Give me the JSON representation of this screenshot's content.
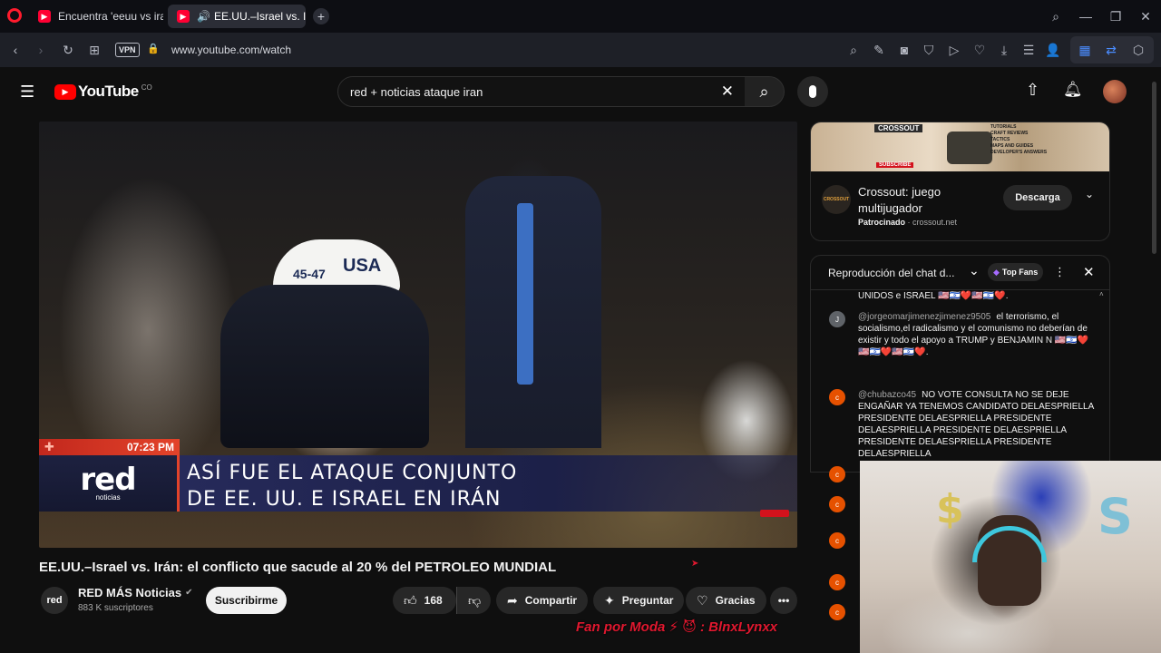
{
  "browser": {
    "tabs": [
      {
        "label": "Encuentra 'eeuu vs iran' en",
        "active": false
      },
      {
        "label": "EE.UU.–Israel vs. Irán: e",
        "active": true
      }
    ],
    "vpn_label": "VPN",
    "url": "www.youtube.com/watch"
  },
  "youtube": {
    "logo_text": "YouTube",
    "country_code": "CO",
    "search_value": "red + noticias ataque iran"
  },
  "video": {
    "time_overlay": "07:23 PM",
    "channel_logo": "red",
    "channel_logo_sub": "noticias",
    "headline_line1": "ASÍ FUE EL ATAQUE CONJUNTO",
    "headline_line2": "DE EE. UU. E ISRAEL EN IRÁN",
    "cap_text": "45-47",
    "cap_text2": "USA",
    "title": "EE.UU.–Israel vs. Irán: el conflicto que sacude al 20 % del PETROLEO MUNDIAL"
  },
  "channel": {
    "name": "RED MÁS Noticias",
    "subscribers": "883 K suscriptores",
    "subscribe_label": "Suscribirme",
    "avatar_text": "red"
  },
  "actions": {
    "likes": "168",
    "share_label": "Compartir",
    "ask_label": "Preguntar",
    "thanks_label": "Gracias"
  },
  "ad": {
    "title": "Crossout: juego multijugador",
    "sponsored": "Patrocinado",
    "domain": "crossout.net",
    "cta": "Descarga",
    "banner_brand": "CROSSOUT",
    "banner_subscribe": "SUBSCRIBE",
    "banner_lines": [
      "TUTORIALS",
      "CRAFT REVIEWS",
      "TACTICS",
      "MAPS AND GUIDES",
      "DEVELOPER'S ANSWERS"
    ],
    "logo_text": "CROSSOUT"
  },
  "chat": {
    "header": "Reproducción del chat d...",
    "top_fans": "Top Fans",
    "partial_first": "UNIDOS e ISRAEL 🇺🇸🇮🇱❤️🇺🇸🇮🇱❤️.",
    "messages": [
      {
        "initial": "J",
        "author": "@jorgeomarjimenezjimenez9505",
        "text": "el terrorismo, el socialismo,el radicalismo y el comunismo no deberían de existir y todo el apoyo a TRUMP y BENJAMIN N 🇺🇸🇮🇱❤️🇺🇸🇮🇱❤️🇺🇸🇮🇱❤️."
      },
      {
        "initial": "c",
        "author": "@chubazco45",
        "text": "NO VOTE CONSULTA NO SE DEJE ENGAÑAR YA TENEMOS CANDIDATO DELAESPRIELLA PRESIDENTE DELAESPRIELLA PRESIDENTE DELAESPRIELLA PRESIDENTE DELAESPRIELLA PRESIDENTE DELAESPRIELLA PRESIDENTE DELAESPRIELLA"
      },
      {
        "initial": "c",
        "author": "",
        "text": ""
      },
      {
        "initial": "c",
        "author": "",
        "text": ""
      },
      {
        "initial": "c",
        "author": "",
        "text": ""
      },
      {
        "initial": "c",
        "author": "",
        "text": ""
      },
      {
        "initial": "c",
        "author": "",
        "text": ""
      }
    ]
  },
  "overlay": {
    "streamer_text": "Fan por Moda ⚡ 😈 : BlnxLynxx"
  },
  "colors": {
    "yt_red": "#ff0000",
    "chat_avatar_orange": "#e65100",
    "chat_avatar_gray": "#5f6368"
  }
}
